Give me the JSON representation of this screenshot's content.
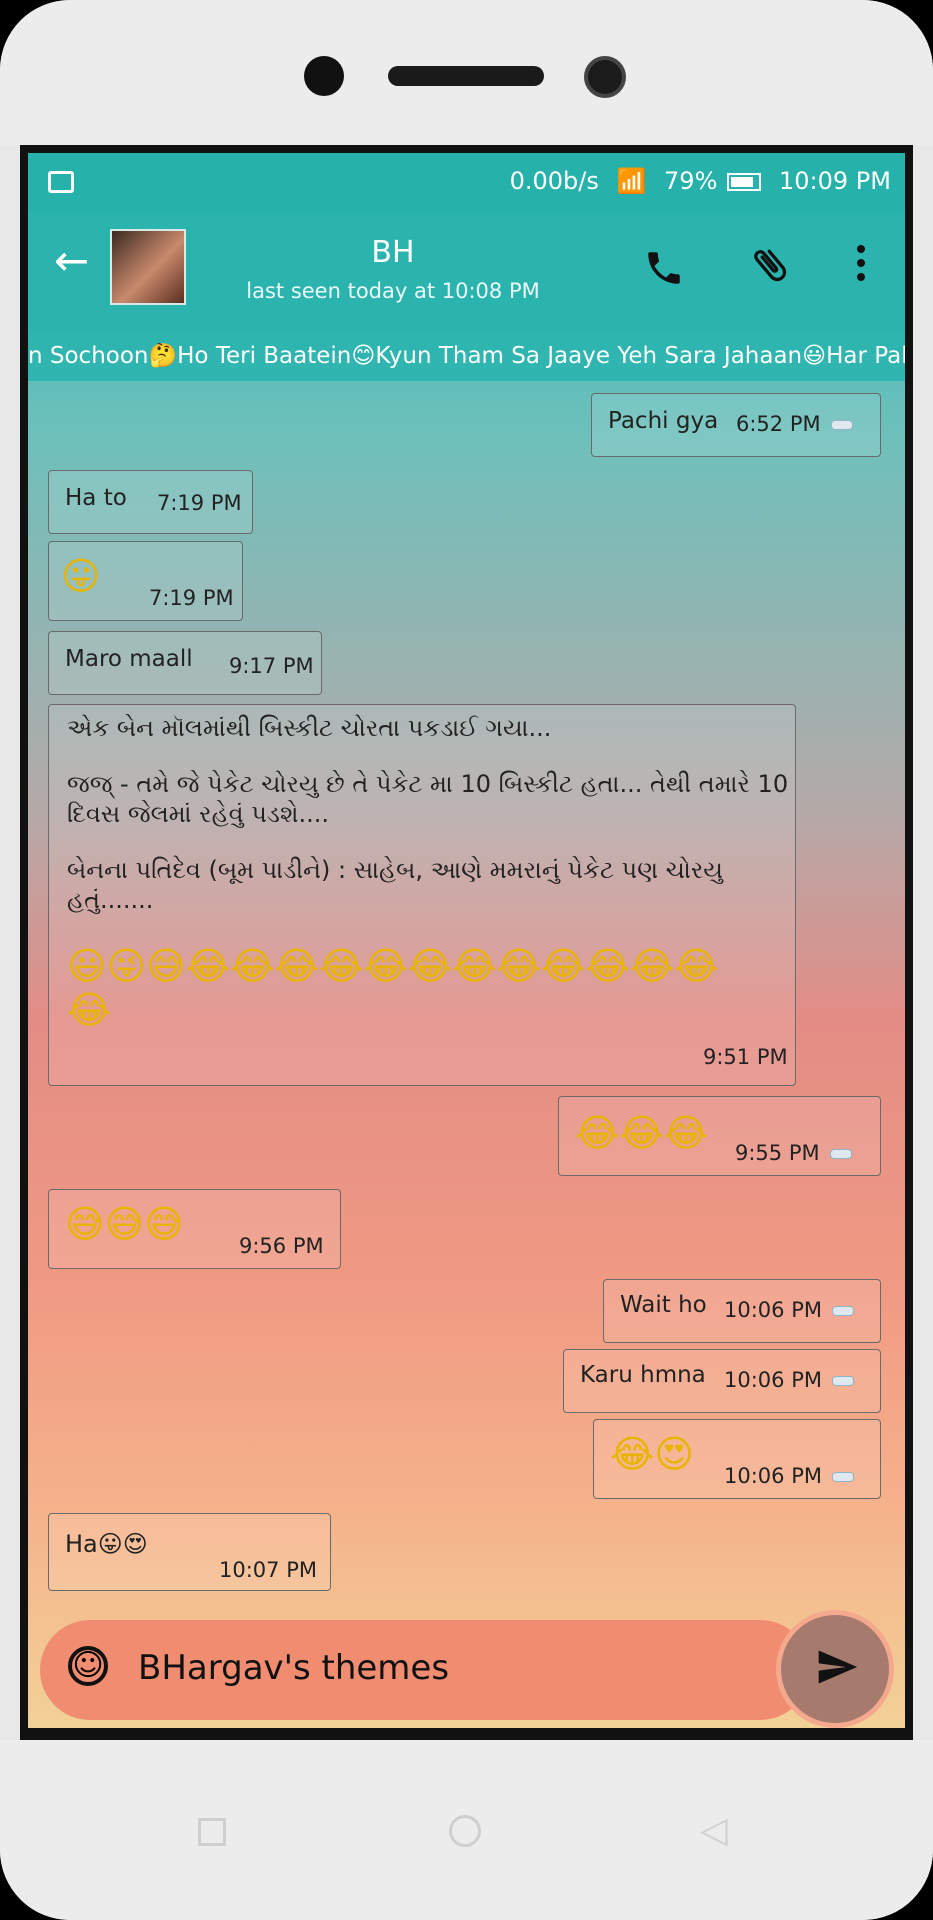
{
  "status_bar": {
    "speed": "0.00b/s",
    "battery": "79%",
    "time": "10:09 PM"
  },
  "header": {
    "contact_name": "BH",
    "last_seen": "last seen today at 10:08 PM"
  },
  "ticker": "n Sochoon🤔Ho Teri Baatein😊Kyun Tham Sa Jaaye Yeh Sara Jahaan😃Har Pal",
  "messages": [
    {
      "text": "Pachi gya",
      "time": "6:52 PM",
      "direction": "out"
    },
    {
      "text": "Ha to",
      "time": "7:19 PM",
      "direction": "in"
    },
    {
      "text": "😛",
      "time": "7:19 PM",
      "direction": "in"
    },
    {
      "text": "Maro maall",
      "time": "9:17 PM",
      "direction": "in"
    },
    {
      "line1": "એક બેન મૉલમાંથી બિસ્કીટ ચોરતા પકડાઈ ગયા...",
      "line2": "જજ્ - તમે જે પેકેટ ચોરયુ છે તે પેકેટ મા 10 બિસ્કીટ હતા... તેથી તમારે 10 દિવસ જેલમાં રહેવું પડશે....",
      "line3": "બેનના પતિદેવ (બૂમ પાડીને) : સાહેબ, આણે મમરાનું પેકેટ પણ ચોરયુ હતું.......",
      "emojis": "😃😜😅😂😂😂😂😂😂😂😂😂😂😂😂😂",
      "time": "9:51 PM",
      "direction": "in"
    },
    {
      "text": "😂😂😂",
      "time": "9:55 PM",
      "direction": "out"
    },
    {
      "text": "😅😅😅",
      "time": "9:56 PM",
      "direction": "in"
    },
    {
      "text": "Wait ho",
      "time": "10:06 PM",
      "direction": "out"
    },
    {
      "text": "Karu hmna",
      "time": "10:06 PM",
      "direction": "out"
    },
    {
      "text": "😂😍",
      "time": "10:06 PM",
      "direction": "out"
    },
    {
      "text": "Ha😛😍",
      "time": "10:07 PM",
      "direction": "in"
    }
  ],
  "input": {
    "value": "BHargav's themes"
  }
}
